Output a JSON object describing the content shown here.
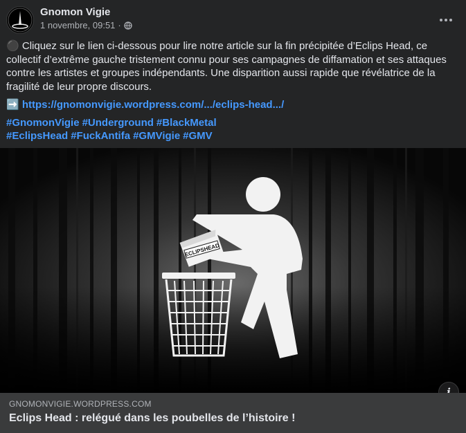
{
  "post": {
    "author": "Gnomon Vigie",
    "date": "1 novembre, 09:51",
    "separator": "·",
    "visibility_icon": "globe-icon",
    "more_icon": "ellipsis-icon",
    "bullet_emoji": "⚫",
    "body": "Cliquez sur le lien ci-dessous pour lire notre article sur la fin précipitée d’Eclips Head, ce collectif d’extrême gauche tristement connu pour ses campagnes de diffamation et ses attaques contre les artistes et groupes indépendants. Une disparition aussi rapide que révélatrice de la fragilité de leur propre discours.",
    "arrow_emoji": "➡️",
    "link": "https://gnomonvigie.wordpress.com/.../eclips-head.../",
    "hashtags": [
      "#GnomonVigie",
      "#Underground",
      "#BlackMetal",
      "#EclipsHead",
      "#FuckAntifa",
      "#GMVigie",
      "#GMV"
    ]
  },
  "media": {
    "paper_label": "ECLIPSHEAD",
    "info_icon": "i"
  },
  "link_card": {
    "domain": "GNOMONVIGIE.WORDPRESS.COM",
    "title": "Eclips Head : relégué dans les poubelles de l’histoire !"
  }
}
